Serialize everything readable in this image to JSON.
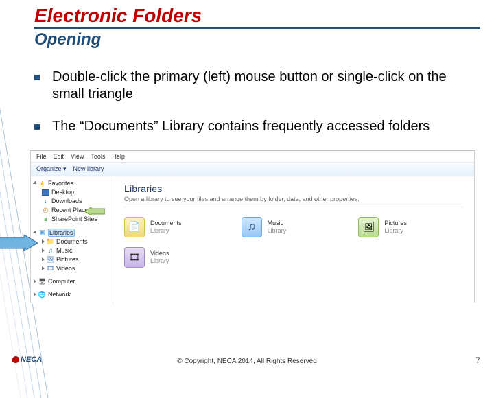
{
  "slide": {
    "title": "Electronic Folders",
    "subtitle": "Opening",
    "bullets": [
      "Double-click the primary (left) mouse button or single-click on the small triangle",
      "The “Documents” Library contains frequently accessed folders"
    ],
    "footer": "© Copyright, NECA 2014, All Rights Reserved",
    "page_number": "7",
    "logo_text": "NECA"
  },
  "explorer": {
    "menu": [
      "File",
      "Edit",
      "View",
      "Tools",
      "Help"
    ],
    "toolbar": {
      "organize": "Organize ▾",
      "new_library": "New library"
    },
    "nav": {
      "favorites": {
        "label": "Favorites",
        "items": [
          "Desktop",
          "Downloads",
          "Recent Places",
          "SharePoint Sites"
        ]
      },
      "libraries": {
        "label": "Libraries",
        "items": [
          "Documents",
          "Music",
          "Pictures",
          "Videos"
        ]
      },
      "computer": {
        "label": "Computer"
      },
      "network": {
        "label": "Network"
      }
    },
    "main": {
      "heading": "Libraries",
      "subtext": "Open a library to see your files and arrange them by folder, date, and other properties.",
      "library_sub": "Library",
      "items": [
        {
          "name": "Documents",
          "kind": "documents"
        },
        {
          "name": "Music",
          "kind": "music"
        },
        {
          "name": "Pictures",
          "kind": "pictures"
        },
        {
          "name": "Videos",
          "kind": "videos"
        }
      ]
    }
  }
}
